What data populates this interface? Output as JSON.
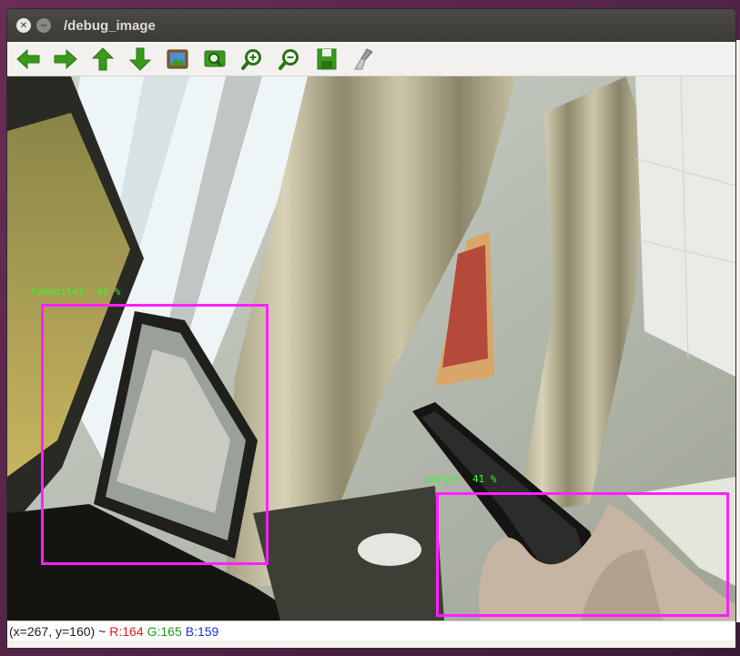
{
  "window": {
    "title": "/debug_image"
  },
  "toolbar": {
    "tools": [
      {
        "icon": "arrow-left-icon"
      },
      {
        "icon": "arrow-right-icon"
      },
      {
        "icon": "arrow-up-icon"
      },
      {
        "icon": "arrow-down-icon"
      },
      {
        "icon": "image-icon"
      },
      {
        "icon": "zoom-fit-icon"
      },
      {
        "icon": "zoom-in-icon"
      },
      {
        "icon": "zoom-out-icon"
      },
      {
        "icon": "save-icon"
      },
      {
        "icon": "brush-icon"
      }
    ]
  },
  "detections": [
    {
      "label": "tvmonitor  41 %"
    },
    {
      "label": "person  41 %"
    }
  ],
  "status": {
    "coords": "(x=267, y=160) ~",
    "r": "R:164",
    "g": "G:165",
    "b": "B:159"
  },
  "colors": {
    "box": "#ff1fff",
    "label": "#2dff2d",
    "toolbar_icon": "#3a9a1b"
  }
}
